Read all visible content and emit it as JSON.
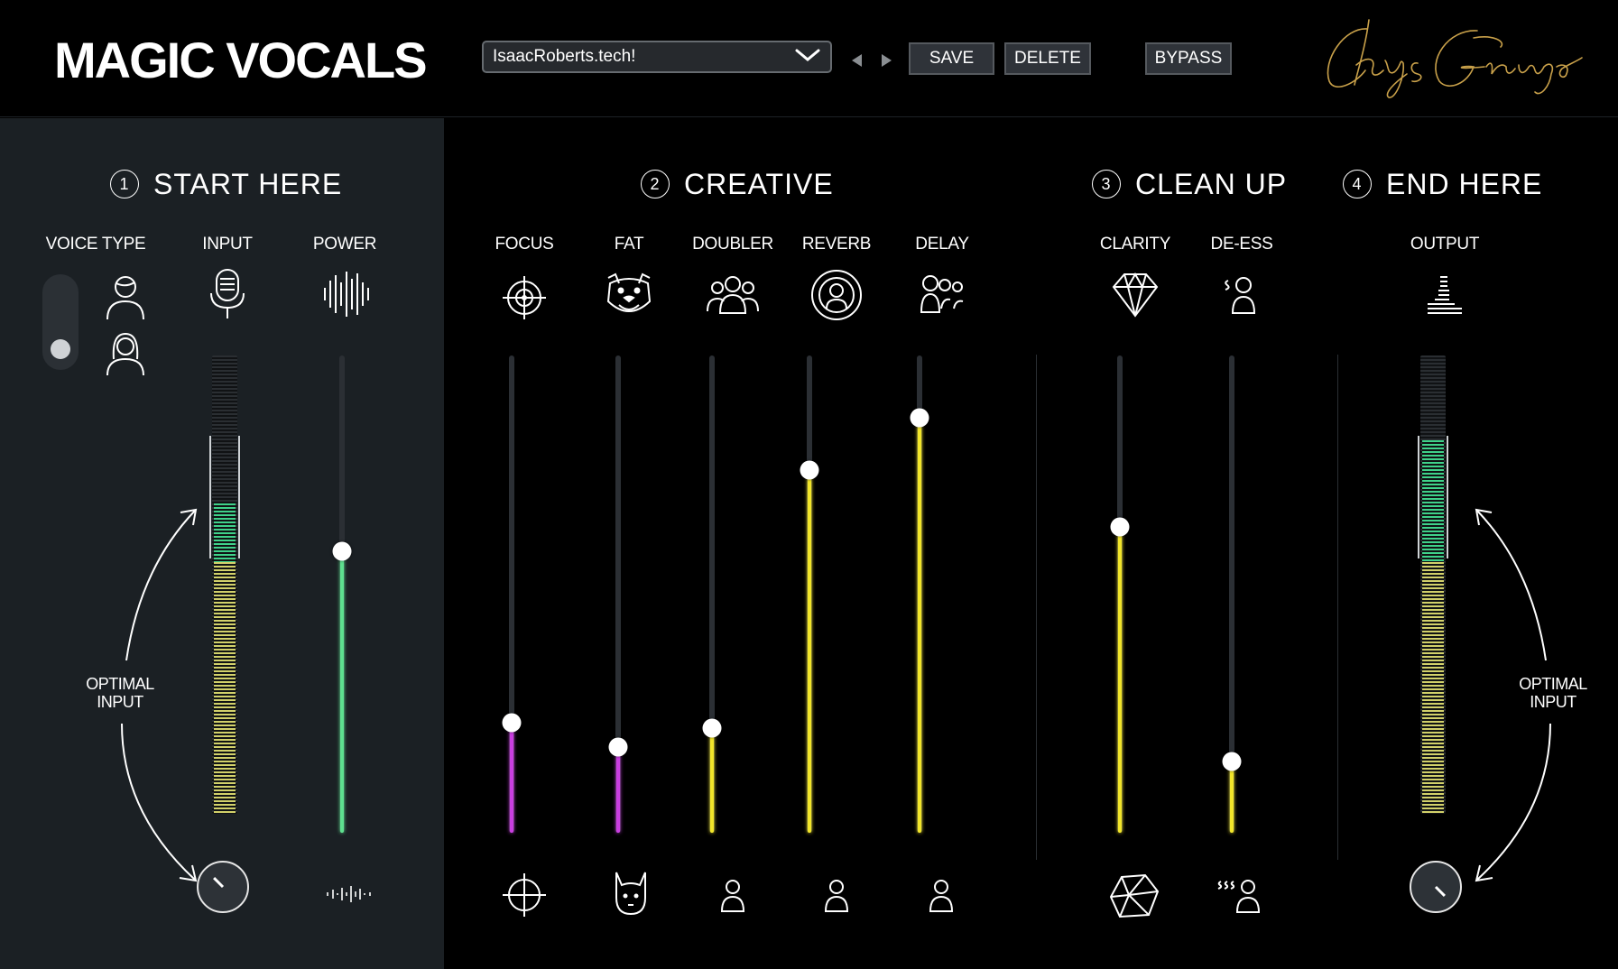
{
  "header": {
    "app_title": "MAGIC VOCALS",
    "preset_value": "IsaacRoberts.tech!",
    "save_label": "SAVE",
    "delete_label": "DELETE",
    "bypass_label": "BYPASS",
    "signature_text": "Chrys Gringo"
  },
  "sections": {
    "start": {
      "num": "1",
      "title": "START HERE"
    },
    "creative": {
      "num": "2",
      "title": "CREATIVE"
    },
    "cleanup": {
      "num": "3",
      "title": "CLEAN UP"
    },
    "end": {
      "num": "4",
      "title": "END HERE"
    }
  },
  "controls": {
    "voice_type": {
      "label": "VOICE TYPE",
      "selected": "female"
    },
    "input": {
      "label": "INPUT",
      "meter_level": 0.63
    },
    "power": {
      "label": "POWER",
      "value": 0.59,
      "color": "#5ee08f"
    },
    "focus": {
      "label": "FOCUS",
      "value": 0.23,
      "color": "#c93ee0"
    },
    "fat": {
      "label": "FAT",
      "value": 0.18,
      "color": "#c93ee0"
    },
    "doubler": {
      "label": "DOUBLER",
      "value": 0.22,
      "color": "#f2e52a"
    },
    "reverb": {
      "label": "REVERB",
      "value": 0.76,
      "color": "#f2e52a"
    },
    "delay": {
      "label": "DELAY",
      "value": 0.87,
      "color": "#f2e52a"
    },
    "clarity": {
      "label": "CLARITY",
      "value": 0.64,
      "color": "#f2e52a"
    },
    "deess": {
      "label": "DE-ESS",
      "value": 0.15,
      "color": "#f2e52a"
    },
    "output": {
      "label": "OUTPUT",
      "meter_level": 0.82
    }
  },
  "optimal_input_left": [
    "OPTIMAL",
    "INPUT"
  ],
  "optimal_input_right": [
    "OPTIMAL",
    "INPUT"
  ],
  "colors": {
    "accent_green": "#5ee08f",
    "accent_yellow": "#f2e52a",
    "accent_purple": "#c93ee0",
    "gold": "#c9a14a"
  }
}
